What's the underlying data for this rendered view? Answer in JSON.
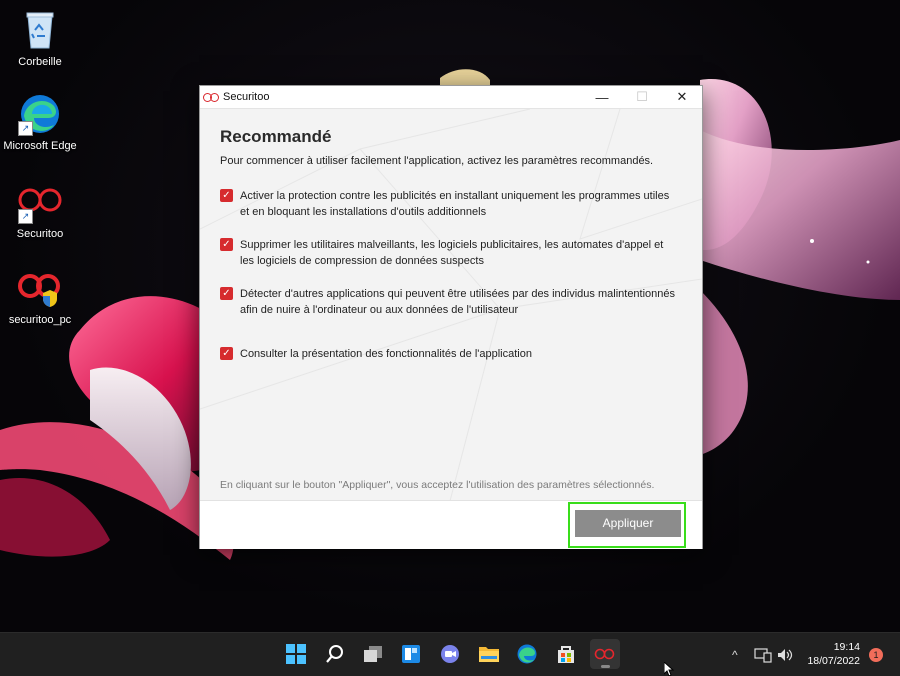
{
  "desktop": {
    "icons": [
      {
        "label": "Corbeille",
        "icon": "recycle-bin-icon"
      },
      {
        "label": "Microsoft Edge",
        "icon": "edge-icon"
      },
      {
        "label": "Securitoo",
        "icon": "securitoo-icon"
      },
      {
        "label": "securitoo_pc",
        "icon": "securitoo-installer-icon"
      }
    ]
  },
  "dialog": {
    "title": "Securitoo",
    "minimize_symbol": "—",
    "maximize_symbol": "☐",
    "close_symbol": "✕",
    "heading": "Recommandé",
    "intro": "Pour commencer à utiliser facilement l'application, activez les paramètres recommandés.",
    "options": [
      {
        "checked": true,
        "text": "Activer la protection contre les publicités en installant uniquement les programmes utiles et en bloquant les installations d'outils additionnels"
      },
      {
        "checked": true,
        "text": "Supprimer les utilitaires malveillants, les logiciels publicitaires, les automates d'appel et les logiciels de compression de données suspects"
      },
      {
        "checked": true,
        "text": "Détecter d'autres applications qui peuvent être utilisées par des individus malintentionnés afin de nuire à l'ordinateur ou aux données de l'utilisateur"
      },
      {
        "checked": true,
        "text": "Consulter la présentation des fonctionnalités de l'application"
      }
    ],
    "check_symbol": "✓",
    "note": "En cliquant sur le bouton \"Appliquer\", vous acceptez l'utilisation des paramètres sélectionnés.",
    "apply_label": "Appliquer",
    "accent_color": "#d62b2e",
    "highlight_color": "#39dd1b"
  },
  "taskbar": {
    "apps": [
      "windows-start-icon",
      "search-icon",
      "task-view-icon",
      "widgets-icon",
      "teams-chat-icon",
      "file-explorer-icon",
      "edge-icon",
      "microsoft-store-icon",
      "securitoo-icon"
    ],
    "tray_chevron": "^",
    "time": "19:14",
    "date": "18/07/2022",
    "notification_count": "1"
  }
}
